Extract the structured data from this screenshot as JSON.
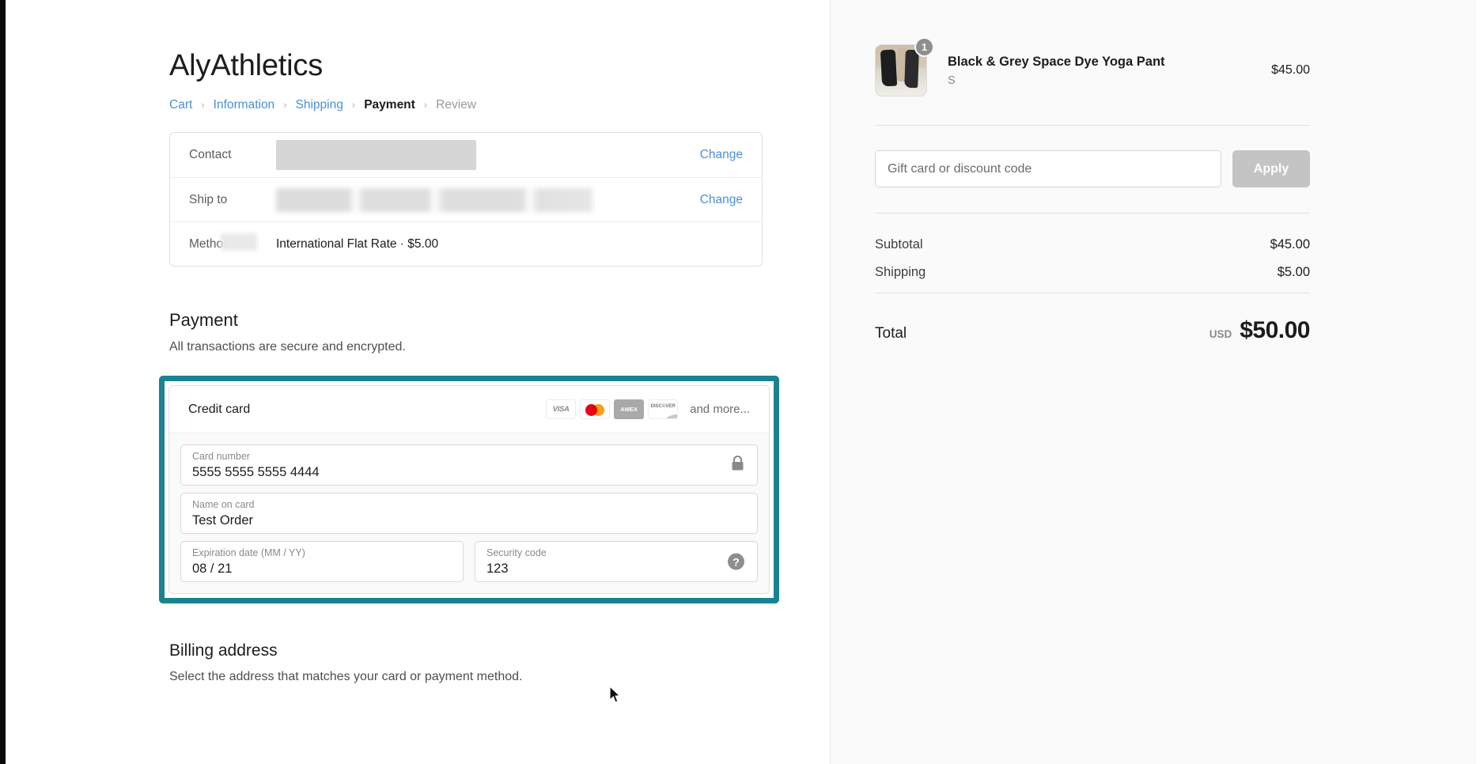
{
  "shop": {
    "title": "AlyAthletics"
  },
  "breadcrumb": {
    "items": [
      {
        "label": "Cart",
        "state": "link"
      },
      {
        "label": "Information",
        "state": "link"
      },
      {
        "label": "Shipping",
        "state": "link"
      },
      {
        "label": "Payment",
        "state": "current"
      },
      {
        "label": "Review",
        "state": "upcoming"
      }
    ],
    "separator": "›"
  },
  "review": {
    "rows": [
      {
        "label": "Contact",
        "value": "",
        "redacted": "block",
        "action": "Change"
      },
      {
        "label": "Ship to",
        "value": "",
        "redacted": "blur",
        "action": "Change"
      },
      {
        "label": "Method",
        "value": "International Flat Rate · $5.00",
        "redacted": "none",
        "action": ""
      }
    ]
  },
  "payment": {
    "heading": "Payment",
    "subheading": "All transactions are secure and encrypted.",
    "card": {
      "type_label": "Credit card",
      "brands": [
        {
          "name": "visa-card-icon",
          "text": "VISA"
        },
        {
          "name": "mastercard-card-icon",
          "text": ""
        },
        {
          "name": "amex-card-icon",
          "text": "AMEX"
        },
        {
          "name": "discover-card-icon",
          "text": "DISC©VER"
        }
      ],
      "and_more": "and more...",
      "fields": {
        "card_number": {
          "label": "Card number",
          "value": "5555 5555 5555 4444",
          "icon": "lock-icon"
        },
        "name_on_card": {
          "label": "Name on card",
          "value": "Test Order",
          "icon": ""
        },
        "expiration": {
          "label": "Expiration date (MM / YY)",
          "value": "08 / 21",
          "icon": ""
        },
        "security_code": {
          "label": "Security code",
          "value": "123",
          "icon": "help-icon",
          "icon_glyph": "?"
        }
      }
    },
    "highlight_color": "#1a8292"
  },
  "billing": {
    "heading": "Billing address",
    "subheading": "Select the address that matches your card or payment method."
  },
  "summary": {
    "item": {
      "title": "Black & Grey Space Dye Yoga Pant",
      "variant": "S",
      "price": "$45.00",
      "quantity": "1"
    },
    "discount": {
      "placeholder": "Gift card or discount code",
      "value": "",
      "apply_label": "Apply"
    },
    "totals": [
      {
        "label": "Subtotal",
        "value": "$45.00"
      },
      {
        "label": "Shipping",
        "value": "$5.00"
      }
    ],
    "grand_total": {
      "label": "Total",
      "currency": "USD",
      "amount": "$50.00"
    }
  },
  "colors": {
    "link": "#4a90d9",
    "highlight": "#1a8292",
    "panel_bg": "#fafafa"
  }
}
